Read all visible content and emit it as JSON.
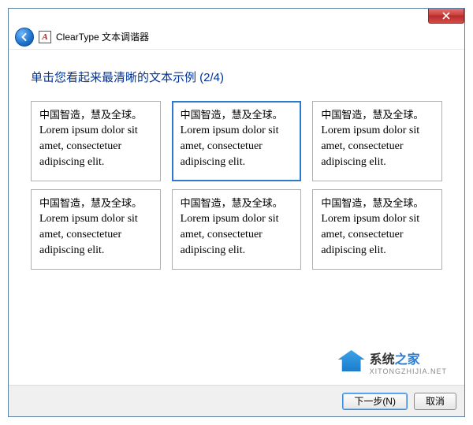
{
  "window": {
    "title": "ClearType 文本调谐器",
    "app_icon_letter": "A"
  },
  "heading": "单击您看起来最清晰的文本示例 (2/4)",
  "sample_text": {
    "cjk": "中国智造，慧及全球。",
    "latin": "Lorem ipsum dolor sit amet, consectetuer adipiscing elit."
  },
  "samples": [
    {
      "selected": false
    },
    {
      "selected": true
    },
    {
      "selected": false
    },
    {
      "selected": false
    },
    {
      "selected": false
    },
    {
      "selected": false
    }
  ],
  "watermark": {
    "text_cn_1": "系统",
    "text_cn_2": "之家",
    "url": "XITONGZHIJIA.NET"
  },
  "footer": {
    "next": "下一步(N)",
    "cancel": "取消"
  }
}
